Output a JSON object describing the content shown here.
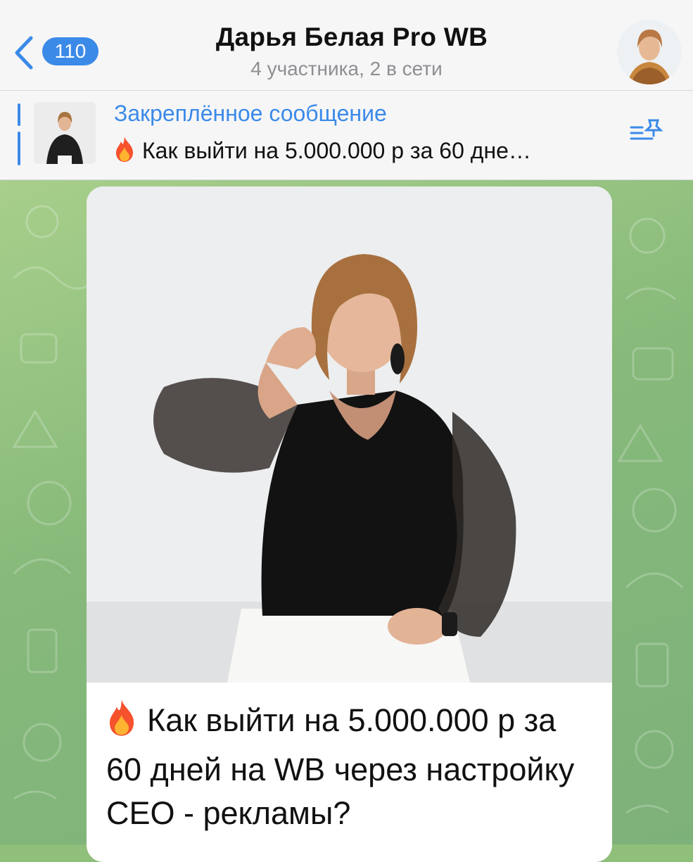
{
  "header": {
    "back_count": "110",
    "title": "Дарья Белая Pro WB",
    "subtitle": "4 участника, 2 в сети"
  },
  "pinned": {
    "label": "Закреплённое сообщение",
    "preview": "Как выйти на 5.000.000 р за 60 дне…"
  },
  "message": {
    "text": "Как выйти на 5.000.000 р за 60 дней на WB через настройку СЕО - рекламы?"
  },
  "colors": {
    "accent": "#3b8ae8",
    "chat_background": "#8fbf7a"
  },
  "icons": [
    "chevron-left-icon",
    "fire-icon",
    "pinned-list-icon"
  ]
}
